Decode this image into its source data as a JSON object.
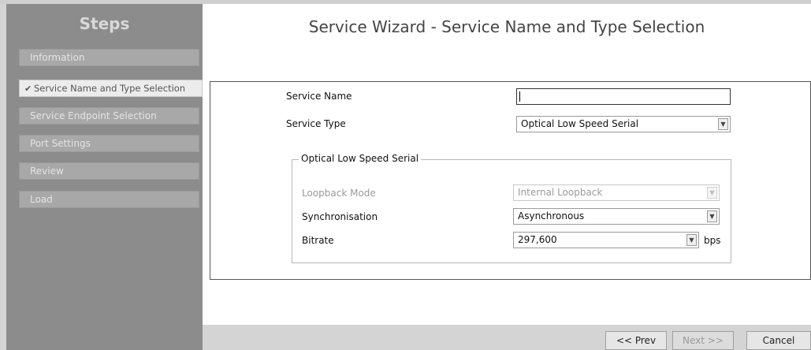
{
  "sidebar": {
    "title": "Steps",
    "steps": [
      {
        "label": "Information",
        "active": false
      },
      {
        "label": "Service Name and Type Selection",
        "active": true,
        "check": "✔"
      },
      {
        "label": "Service Endpoint Selection",
        "active": false
      },
      {
        "label": "Port Settings",
        "active": false
      },
      {
        "label": "Review",
        "active": false
      },
      {
        "label": "Load",
        "active": false
      }
    ]
  },
  "main": {
    "title": "Service Wizard - Service Name and Type Selection",
    "form": {
      "service_name_label": "Service Name",
      "service_name_value": "",
      "service_type_label": "Service Type",
      "service_type_value": "Optical Low Speed Serial"
    },
    "group": {
      "legend": "Optical Low Speed Serial",
      "loopback_label": "Loopback Mode",
      "loopback_value": "Internal Loopback",
      "sync_label": "Synchronisation",
      "sync_value": "Asynchronous",
      "bitrate_label": "Bitrate",
      "bitrate_value": "297,600",
      "bitrate_unit": "bps"
    }
  },
  "footer": {
    "prev_label": "<< Prev",
    "next_label": "Next >>",
    "cancel_label": "Cancel"
  },
  "icons": {
    "dropdown_arrow": "chevron-down-icon",
    "check": "check-icon"
  }
}
